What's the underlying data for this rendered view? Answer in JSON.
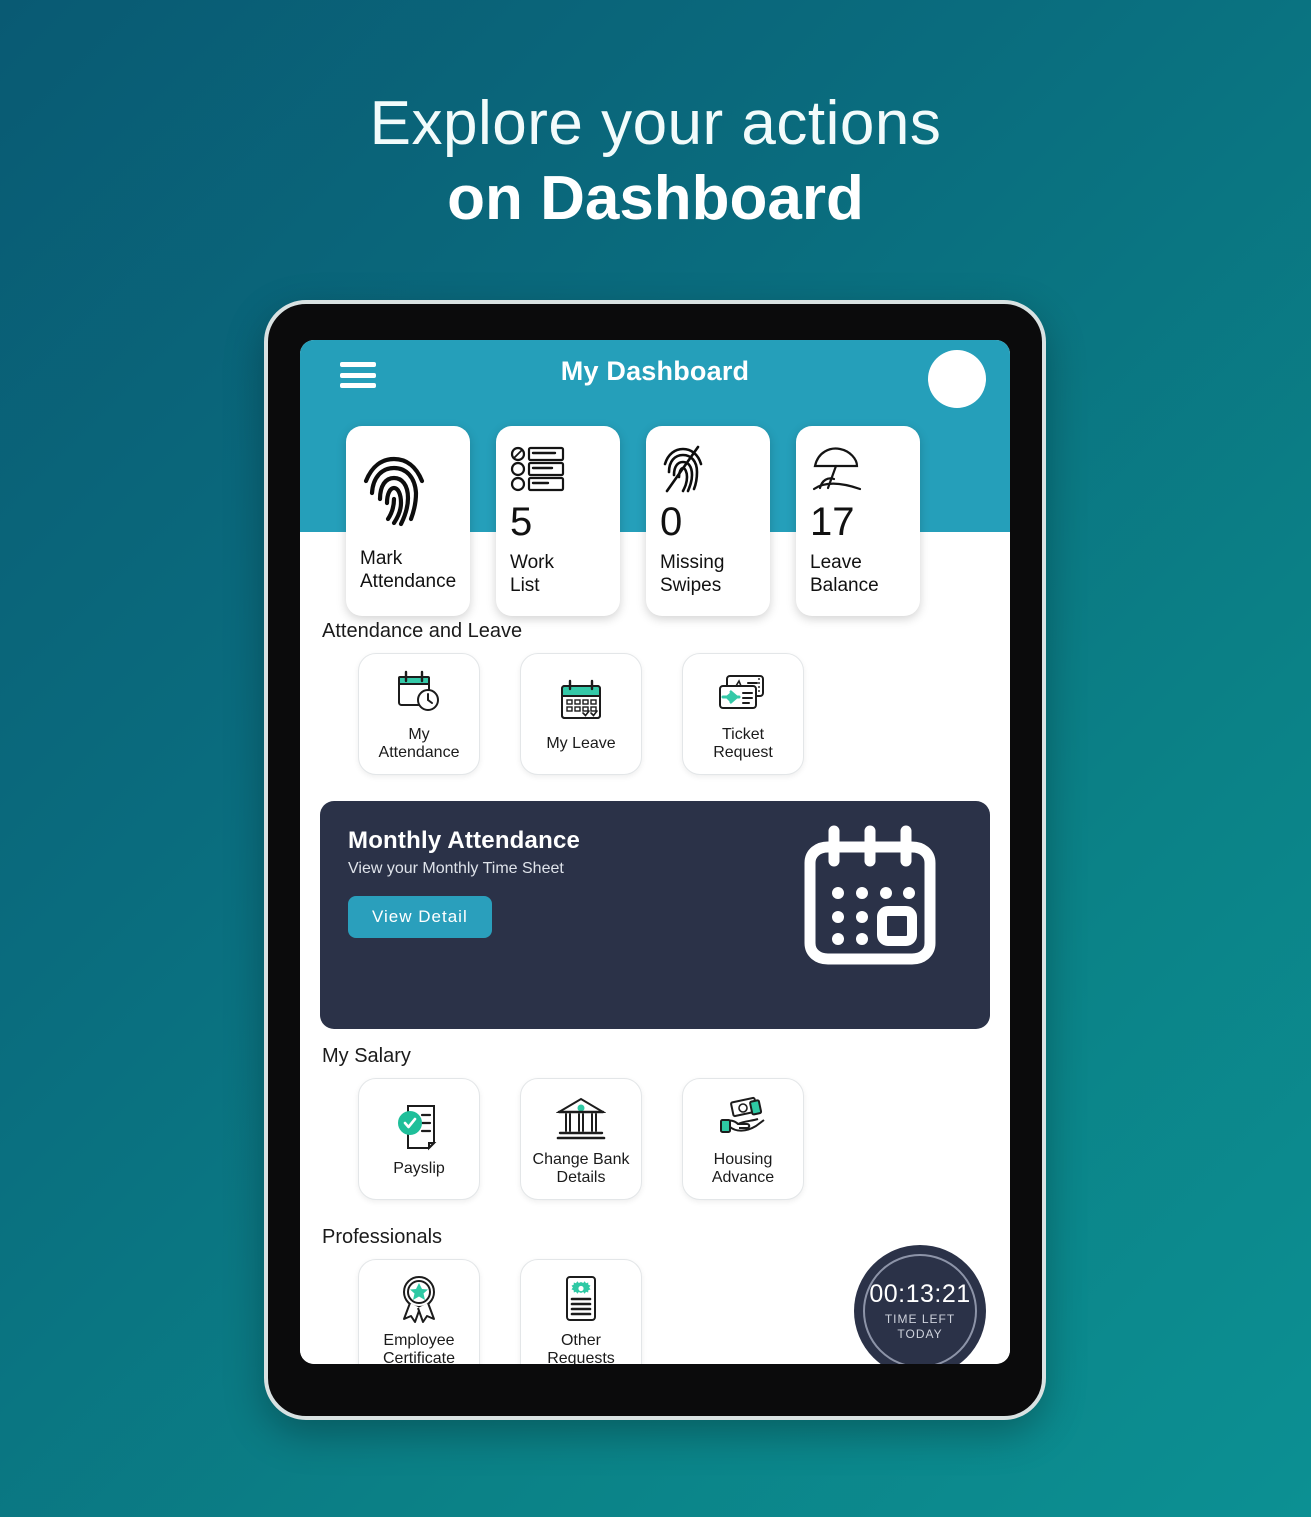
{
  "promo": {
    "line1": "Explore your actions",
    "line2": "on Dashboard"
  },
  "header": {
    "title": "My Dashboard",
    "menu_icon": "hamburger-menu-icon",
    "avatar_icon": "user-avatar"
  },
  "stat_cards": [
    {
      "icon": "fingerprint-icon",
      "value": "",
      "label": "Mark\nAttendance"
    },
    {
      "icon": "checklist-icon",
      "value": "5",
      "label": "Work\nList"
    },
    {
      "icon": "fingerprint-slash-icon",
      "value": "0",
      "label": "Missing\nSwipes"
    },
    {
      "icon": "beach-umbrella-icon",
      "value": "17",
      "label": "Leave\nBalance"
    }
  ],
  "sections": [
    {
      "title": "Attendance and Leave",
      "tiles": [
        {
          "icon": "calendar-clock-icon",
          "label": "My\nAttendance"
        },
        {
          "icon": "calendar-check-icon",
          "label": "My Leave"
        },
        {
          "icon": "flight-ticket-icon",
          "label": "Ticket\nRequest"
        }
      ]
    },
    {
      "title": "My Salary",
      "tiles": [
        {
          "icon": "payslip-check-icon",
          "label": "Payslip"
        },
        {
          "icon": "bank-icon",
          "label": "Change Bank\nDetails"
        },
        {
          "icon": "hand-money-icon",
          "label": "Housing\nAdvance"
        }
      ]
    },
    {
      "title": "Professionals",
      "tiles": [
        {
          "icon": "award-ribbon-icon",
          "label": "Employee\nCertificate"
        },
        {
          "icon": "document-gear-icon",
          "label": "Other\nRequests"
        }
      ]
    }
  ],
  "banner": {
    "title": "Monthly Attendance",
    "subtitle": "View your Monthly Time Sheet",
    "button_label": "View Detail",
    "art_icon": "calendar-large-icon"
  },
  "timer": {
    "value": "00:13:21",
    "caption_line1": "TIME LEFT",
    "caption_line2": "TODAY"
  },
  "colors": {
    "background_start": "#095a73",
    "background_end": "#0c9093",
    "app_header": "#259fba",
    "accent_teal": "#2a9fbc",
    "icon_accent": "#3fcfa8",
    "banner_bg": "#2b3248",
    "card_bg": "#ffffff",
    "text_dark": "#1b1b1b"
  }
}
